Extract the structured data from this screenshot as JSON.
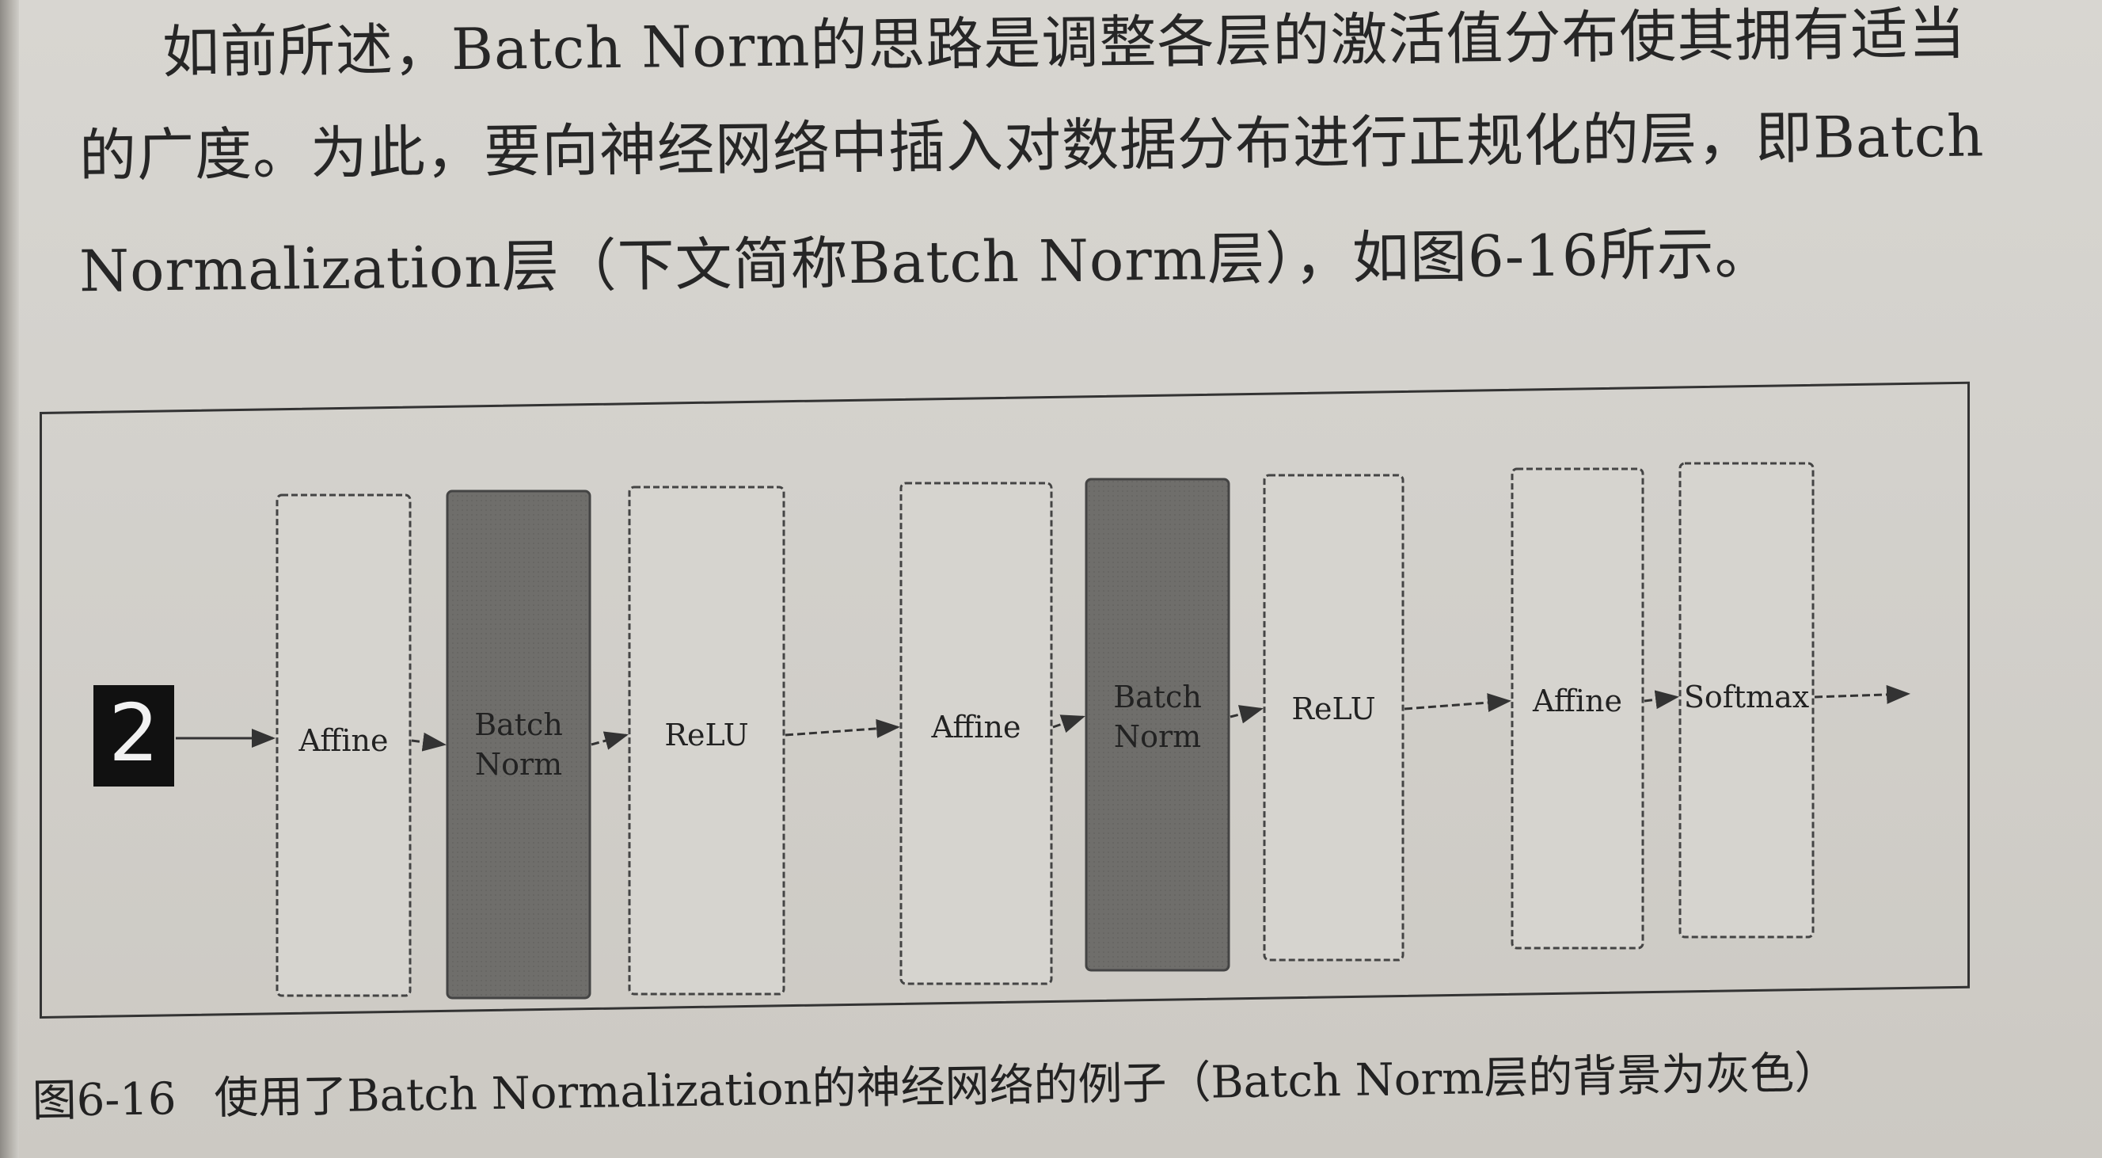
{
  "paragraph": {
    "line1": "如前所述，Batch Norm的思路是调整各层的激活值分布使其拥有适当",
    "line2": "的广度。为此，要向神经网络中插入对数据分布进行正规化的层，即Batch",
    "line3": "Normalization层（下文简称Batch Norm层），如图6-16所示。"
  },
  "figure": {
    "input_digit": "2",
    "layers": [
      {
        "label": "Affine",
        "shaded": false
      },
      {
        "label": "Batch\nNorm",
        "shaded": true
      },
      {
        "label": "ReLU",
        "shaded": false
      },
      {
        "label": "Affine",
        "shaded": false
      },
      {
        "label": "Batch\nNorm",
        "shaded": true
      },
      {
        "label": "ReLU",
        "shaded": false
      },
      {
        "label": "Affine",
        "shaded": false
      },
      {
        "label": "Softmax",
        "shaded": false
      }
    ],
    "colors": {
      "shaded_fill": "#6f6e6b",
      "plain_fill": "#d6d4cf",
      "border": "#444444",
      "input_bg": "#111111",
      "input_fg": "#f2f2f2"
    }
  },
  "caption": {
    "number": "图6-16",
    "text": "使用了Batch Normalization的神经网络的例子（Batch Norm层的背景为灰色）"
  }
}
